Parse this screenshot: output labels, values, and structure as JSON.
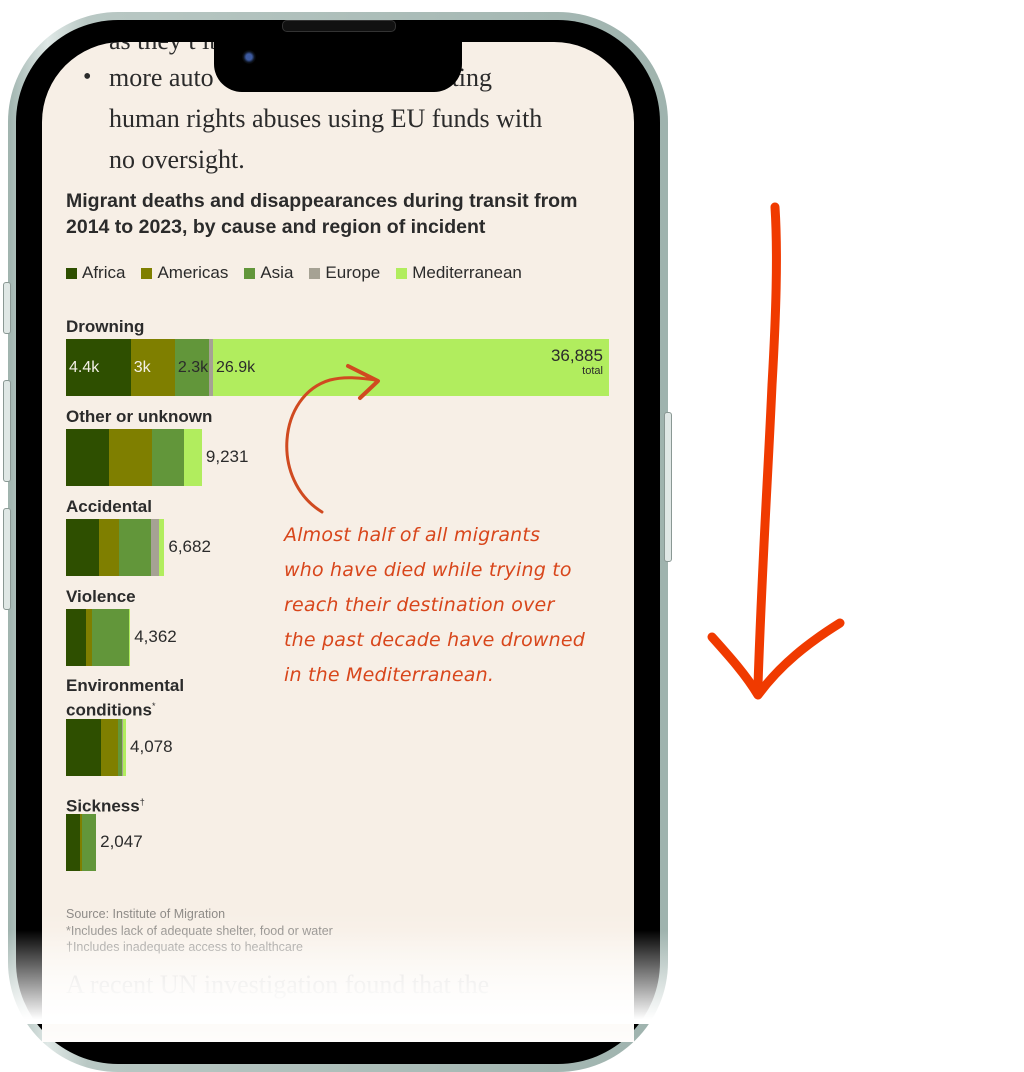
{
  "article": {
    "partial_line": "as they t                              ibutes, and",
    "bullet_text": "more autocrats and militias committing human rights abuses using EU funds with no oversight.",
    "bullet_visible_start": "more auto",
    "bullet_visible_end": "ommitting",
    "bullet_line2": "human rights abuses using EU funds with",
    "bullet_line3": "no oversight.",
    "next_paragraph": "A recent UN investigation found that the"
  },
  "chart_data": {
    "type": "bar",
    "orientation": "horizontal",
    "stacked": true,
    "title": "Migrant deaths and disappearances during transit from 2014 to 2023, by cause and region of incident",
    "legend": [
      {
        "name": "Africa",
        "color": "#2e4f00"
      },
      {
        "name": "Americas",
        "color": "#7f7f00"
      },
      {
        "name": "Asia",
        "color": "#62963a"
      },
      {
        "name": "Europe",
        "color": "#a6a294"
      },
      {
        "name": "Mediterranean",
        "color": "#b1ed5e"
      }
    ],
    "legend_position": "top-left",
    "categories": [
      "Drowning",
      "Other or unknown",
      "Accidental",
      "Violence",
      "Environmental conditions",
      "Sickness"
    ],
    "category_marks": [
      "",
      "",
      "",
      "",
      "*",
      "†"
    ],
    "series": [
      {
        "name": "Africa",
        "values": [
          4400,
          2920,
          2240,
          1360,
          2380,
          950
        ]
      },
      {
        "name": "Americas",
        "values": [
          3000,
          2920,
          1360,
          410,
          1160,
          140
        ]
      },
      {
        "name": "Asia",
        "values": [
          2300,
          2170,
          2170,
          2530,
          270,
          957
        ]
      },
      {
        "name": "Europe",
        "values": [
          285,
          0,
          540,
          0,
          70,
          0
        ]
      },
      {
        "name": "Mediterranean",
        "values": [
          26900,
          1221,
          372,
          62,
          198,
          0
        ]
      }
    ],
    "totals": [
      36885,
      9231,
      6682,
      4362,
      4078,
      2047
    ],
    "total_labels": [
      "36,885",
      "9,231",
      "6,682",
      "4,362",
      "4,078",
      "2,047"
    ],
    "total_suffix": "total",
    "segment_labels_drowning": [
      "4.4k",
      "3k",
      "2.3k",
      "",
      "26.9k"
    ],
    "xlim": [
      0,
      36885
    ],
    "grid": false
  },
  "annotation": {
    "text": "Almost half of all migrants who have died while trying to reach their destination over the past decade have drowned in the Mediterranean.",
    "lines": [
      "Almost half of all migrants",
      "who have died while trying to",
      "reach their destination over",
      "the past decade have drowned",
      "in the Mediterranean."
    ],
    "color": "#d8461b"
  },
  "footnotes": {
    "source": "Source: Institute of Migration",
    "note1": "*Includes lack of adequate shelter, food or water",
    "note2": "†Includes inadequate access to healthcare"
  },
  "colors": {
    "page_bg": "#f7efe6",
    "arrow": "#f03a00",
    "text": "#2b2b2b"
  }
}
